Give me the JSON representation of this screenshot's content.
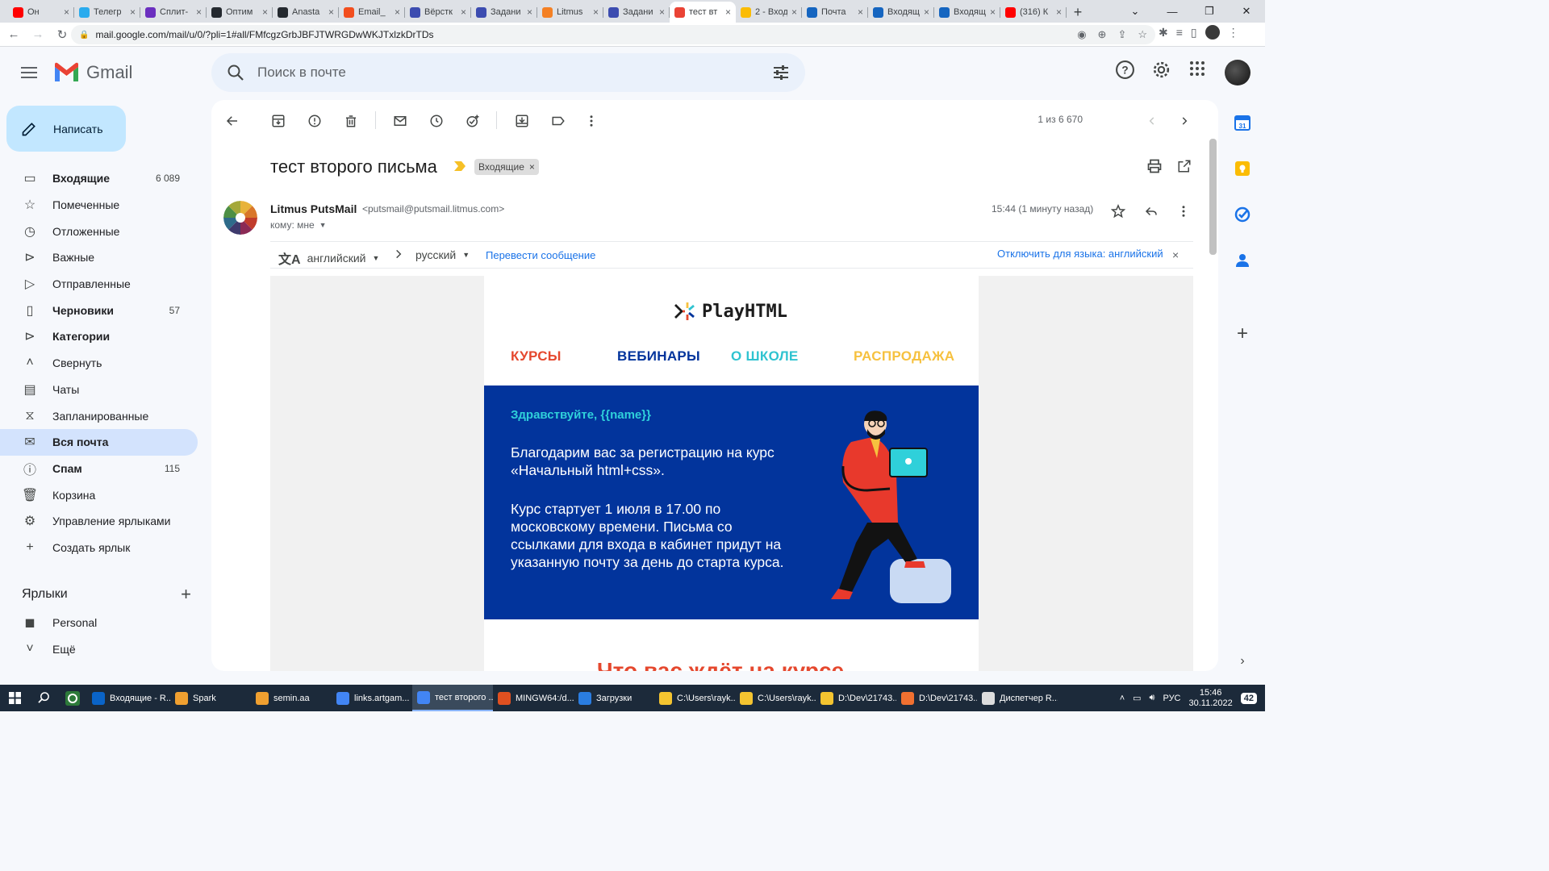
{
  "browser": {
    "tabs": [
      {
        "title": "Он",
        "color": "#ff0000"
      },
      {
        "title": "Телегр",
        "color": "#2aabee"
      },
      {
        "title": "Сплит-",
        "color": "#6b2fbf"
      },
      {
        "title": "Оптим",
        "color": "#24292f"
      },
      {
        "title": "Anasta",
        "color": "#24292f"
      },
      {
        "title": "Email_",
        "color": "#f24e1e"
      },
      {
        "title": "Вёрстк",
        "color": "#3c4cb0"
      },
      {
        "title": "Задани",
        "color": "#3c4cb0"
      },
      {
        "title": "Litmus",
        "color": "#f48024"
      },
      {
        "title": "Задани",
        "color": "#3c4cb0"
      },
      {
        "title": "тест вт",
        "color": "#ea4335",
        "active": true
      },
      {
        "title": "2 - Вход",
        "color": "#fbbc04"
      },
      {
        "title": "Почта",
        "color": "#1565c0"
      },
      {
        "title": "Входящ",
        "color": "#1565c0"
      },
      {
        "title": "Входящ",
        "color": "#1565c0"
      },
      {
        "title": "(316) К",
        "color": "#ff0000"
      }
    ],
    "url": "mail.google.com/mail/u/0/?pli=1#all/FMfcgzGrbJBFJTWRGDwWKJTxlzkDrTDs"
  },
  "gmail": {
    "app_name": "Gmail",
    "search_placeholder": "Поиск в почте",
    "compose_label": "Написать",
    "nav": [
      {
        "label": "Входящие",
        "count": "6 089",
        "icon": "inbox-icon",
        "bold": true
      },
      {
        "label": "Помеченные",
        "count": "",
        "icon": "star-icon"
      },
      {
        "label": "Отложенные",
        "count": "",
        "icon": "clock-icon"
      },
      {
        "label": "Важные",
        "count": "",
        "icon": "important-icon"
      },
      {
        "label": "Отправленные",
        "count": "",
        "icon": "send-icon"
      },
      {
        "label": "Черновики",
        "count": "57",
        "icon": "draft-icon",
        "bold": true
      },
      {
        "label": "Категории",
        "count": "",
        "icon": "label-icon",
        "bold": true
      },
      {
        "label": "Свернуть",
        "count": "",
        "icon": "chevron-up-icon"
      },
      {
        "label": "Чаты",
        "count": "",
        "icon": "chat-icon"
      },
      {
        "label": "Запланированные",
        "count": "",
        "icon": "scheduled-icon"
      },
      {
        "label": "Вся почта",
        "count": "",
        "icon": "all-mail-icon",
        "active": true
      },
      {
        "label": "Спам",
        "count": "115",
        "icon": "spam-icon",
        "bold": true
      },
      {
        "label": "Корзина",
        "count": "",
        "icon": "trash-icon"
      },
      {
        "label": "Управление ярлыками",
        "count": "",
        "icon": "gear-icon"
      },
      {
        "label": "Создать ярлык",
        "count": "",
        "icon": "plus-icon"
      }
    ],
    "labels_title": "Ярлыки",
    "labels": [
      {
        "label": "Personal",
        "icon": "label-filled-icon"
      },
      {
        "label": "Ещё",
        "icon": "chevron-down-icon"
      }
    ]
  },
  "message": {
    "pager": "1 из 6 670",
    "subject": "тест второго письма",
    "label_chip": "Входящие",
    "sender_name": "Litmus PutsMail",
    "sender_email": "<putsmail@putsmail.litmus.com>",
    "recipient": "кому: мне",
    "timestamp": "15:44 (1 минуту назад)",
    "translate": {
      "from": "английский",
      "to": "русский",
      "action": "Перевести сообщение",
      "disable": "Отключить для языка: английский"
    }
  },
  "email": {
    "brand": "PlayHTML",
    "menu": [
      {
        "label": "КУРСЫ",
        "color": "#e5482e"
      },
      {
        "label": "ВЕБИНАРЫ",
        "color": "#02349c"
      },
      {
        "label": "О ШКОЛЕ",
        "color": "#2fc3d0"
      },
      {
        "label": "РАСПРОДАЖА",
        "color": "#f6c13f"
      }
    ],
    "greeting": "Здравствуйте, {{name}}",
    "paragraph1": "Благодарим вас за регистрацию на курс «Начальный html+css».",
    "paragraph2": "Курс стартует 1 июля в 17.00 по московскому времени. Письма со ссылками для входа в кабинет придут на указанную почту за день до старта курса.",
    "section_title": "Что вас ждёт на курсе",
    "colors": {
      "banner": "#02349c",
      "greeting": "#2fd0da"
    }
  },
  "taskbar": {
    "items": [
      {
        "label": "Входящие - R...",
        "color": "#0a64c8"
      },
      {
        "label": "Spark",
        "color": "#f0a030"
      },
      {
        "label": "semin.aa",
        "color": "#f0a030"
      },
      {
        "label": "links.artgam...",
        "color": "#4285f4"
      },
      {
        "label": "тест второго ...",
        "color": "#4285f4",
        "active": true
      },
      {
        "label": "MINGW64:/d...",
        "color": "#e05020"
      },
      {
        "label": "Загрузки",
        "color": "#2a7de1"
      },
      {
        "label": "C:\\Users\\rayk...",
        "color": "#f4c430"
      },
      {
        "label": "C:\\Users\\rayk...",
        "color": "#f4c430"
      },
      {
        "label": "D:\\Dev\\21743...",
        "color": "#f4c430"
      },
      {
        "label": "D:\\Dev\\21743...",
        "color": "#f07030"
      },
      {
        "label": "Диспетчер R...",
        "color": "#dddddd"
      }
    ],
    "lang": "РУС",
    "time": "15:46",
    "date": "30.11.2022",
    "notifications": "42"
  }
}
